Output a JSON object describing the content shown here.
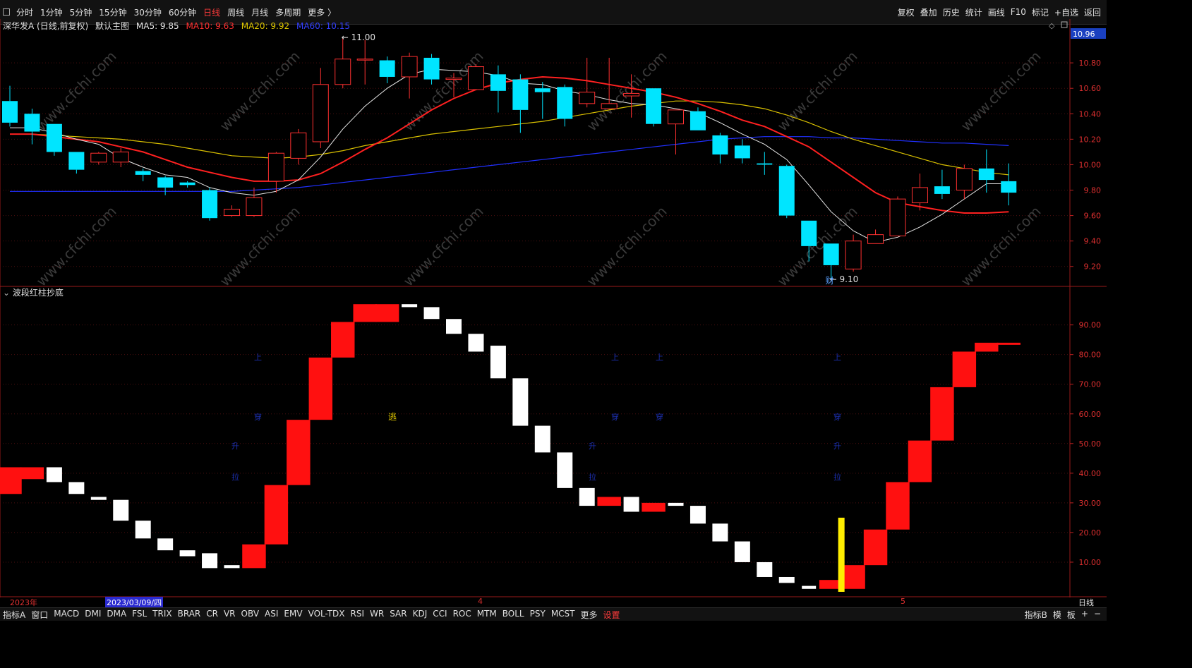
{
  "topbar": {
    "periods": [
      "分时",
      "1分钟",
      "5分钟",
      "15分钟",
      "30分钟",
      "60分钟",
      "日线",
      "周线",
      "月线",
      "多周期",
      "更多 〉"
    ],
    "active_period": "日线",
    "right_buttons": [
      "复权",
      "叠加",
      "历史",
      "统计",
      "画线",
      "F10",
      "标记",
      "+自选",
      "返回"
    ]
  },
  "legend": {
    "title": "深华发A (日线,前复权)",
    "main_chart": "默认主图",
    "ma5": "MA5: 9.85",
    "ma10": "MA10: 9.63",
    "ma20": "MA20: 9.92",
    "ma60": "MA60: 10.15"
  },
  "price_axis": {
    "current_price": "10.96",
    "ticks": [
      "10.80",
      "10.60",
      "10.40",
      "10.20",
      "10.00",
      "9.80",
      "9.60",
      "9.40",
      "9.20"
    ]
  },
  "annotations": {
    "high_label": "11.00",
    "low_label": "9.10",
    "fin_mark": "财"
  },
  "indicator": {
    "title": "波段红柱抄底",
    "ticks": [
      "90.00",
      "80.00",
      "70.00",
      "60.00",
      "50.00",
      "40.00",
      "30.00",
      "20.00",
      "10.00"
    ],
    "signal_escape": "逃",
    "signal_chars": [
      "上",
      "穿",
      "升",
      "拉"
    ]
  },
  "datebar": {
    "year": "2023年",
    "cursor_date": "2023/03/09/四",
    "month4": "4",
    "month5": "5",
    "period": "日线"
  },
  "bottombar": {
    "indicators": [
      "指标A",
      "窗口",
      "MACD",
      "DMI",
      "DMA",
      "FSL",
      "TRIX",
      "BRAR",
      "CR",
      "VR",
      "OBV",
      "ASI",
      "EMV",
      "VOL-TDX",
      "RSI",
      "WR",
      "SAR",
      "KDJ",
      "CCI",
      "ROC",
      "MTM",
      "BOLL",
      "PSY",
      "MCST",
      "更多",
      "设置"
    ],
    "right": [
      "指标B",
      "模",
      "板",
      "+",
      "−"
    ]
  },
  "watermark": "www.cfchi.com",
  "colors": {
    "up": "#ff3030",
    "down": "#00e5ff",
    "ma5": "#e6e6e6",
    "ma10": "#ff2020",
    "ma20": "#d9c000",
    "ma60": "#2030ff"
  },
  "chart_data": [
    {
      "type": "candlestick",
      "ylim": [
        9.06,
        11.1
      ],
      "candles": [
        [
          10.5,
          10.33,
          10.62,
          10.3
        ],
        [
          10.4,
          10.26,
          10.44,
          10.16
        ],
        [
          10.32,
          10.1,
          10.32,
          10.07
        ],
        [
          10.1,
          9.96,
          10.1,
          9.93
        ],
        [
          10.02,
          10.09,
          10.1,
          10.0
        ],
        [
          10.02,
          10.1,
          10.13,
          9.98
        ],
        [
          9.95,
          9.92,
          9.97,
          9.87
        ],
        [
          9.9,
          9.82,
          9.91,
          9.76
        ],
        [
          9.86,
          9.84,
          9.87,
          9.82
        ],
        [
          9.8,
          9.58,
          9.82,
          9.56
        ],
        [
          9.6,
          9.65,
          9.68,
          9.59
        ],
        [
          9.6,
          9.74,
          9.82,
          9.59
        ],
        [
          9.87,
          10.09,
          10.1,
          9.78
        ],
        [
          10.05,
          10.25,
          10.28,
          10.0
        ],
        [
          10.18,
          10.63,
          10.76,
          10.13
        ],
        [
          10.63,
          10.83,
          11.0,
          10.6
        ],
        [
          10.83,
          10.83,
          10.98,
          10.63
        ],
        [
          10.82,
          10.69,
          10.85,
          10.64
        ],
        [
          10.69,
          10.85,
          10.88,
          10.52
        ],
        [
          10.84,
          10.67,
          10.87,
          10.63
        ],
        [
          10.67,
          10.68,
          10.72,
          10.53
        ],
        [
          10.59,
          10.77,
          10.79,
          10.59
        ],
        [
          10.71,
          10.58,
          10.78,
          10.41
        ],
        [
          10.67,
          10.43,
          10.71,
          10.25
        ],
        [
          10.6,
          10.57,
          10.65,
          10.36
        ],
        [
          10.61,
          10.36,
          10.63,
          10.3
        ],
        [
          10.48,
          10.57,
          10.84,
          10.45
        ],
        [
          10.44,
          10.48,
          10.84,
          10.44
        ],
        [
          10.54,
          10.56,
          10.71,
          10.37
        ],
        [
          10.6,
          10.32,
          10.6,
          10.3
        ],
        [
          10.32,
          10.43,
          10.43,
          10.08
        ],
        [
          10.42,
          10.27,
          10.45,
          10.27
        ],
        [
          10.23,
          10.08,
          10.25,
          10.01
        ],
        [
          10.15,
          10.05,
          10.2,
          10.01
        ],
        [
          10.01,
          10.0,
          10.1,
          9.92
        ],
        [
          9.99,
          9.6,
          10.0,
          9.58
        ],
        [
          9.56,
          9.36,
          9.56,
          9.24
        ],
        [
          9.38,
          9.21,
          9.38,
          9.1
        ],
        [
          9.18,
          9.4,
          9.45,
          9.16
        ],
        [
          9.38,
          9.45,
          9.49,
          9.38
        ],
        [
          9.44,
          9.73,
          9.75,
          9.44
        ],
        [
          9.7,
          9.82,
          9.93,
          9.64
        ],
        [
          9.83,
          9.77,
          9.96,
          9.73
        ],
        [
          9.8,
          9.97,
          10.0,
          9.73
        ],
        [
          9.97,
          9.88,
          10.12,
          9.78
        ],
        [
          9.87,
          9.78,
          10.01,
          9.68
        ]
      ],
      "ma5": [
        10.29,
        10.29,
        10.25,
        10.2,
        10.16,
        10.05,
        9.98,
        9.92,
        9.9,
        9.82,
        9.78,
        9.76,
        9.79,
        9.88,
        10.06,
        10.28,
        10.46,
        10.6,
        10.71,
        10.75,
        10.74,
        10.73,
        10.7,
        10.64,
        10.63,
        10.58,
        10.55,
        10.51,
        10.48,
        10.47,
        10.44,
        10.41,
        10.33,
        10.24,
        10.16,
        10.04,
        9.84,
        9.63,
        9.48,
        9.39,
        9.43,
        9.51,
        9.61,
        9.73,
        9.85,
        9.85
      ],
      "ma10": [
        10.24,
        10.24,
        10.22,
        10.2,
        10.18,
        10.14,
        10.1,
        10.04,
        9.98,
        9.94,
        9.9,
        9.87,
        9.87,
        9.88,
        9.93,
        10.02,
        10.12,
        10.21,
        10.32,
        10.43,
        10.52,
        10.59,
        10.64,
        10.67,
        10.69,
        10.68,
        10.66,
        10.63,
        10.6,
        10.57,
        10.53,
        10.48,
        10.42,
        10.35,
        10.3,
        10.22,
        10.14,
        10.02,
        9.9,
        9.78,
        9.7,
        9.67,
        9.64,
        9.62,
        9.62,
        9.63
      ],
      "ma20": [
        10.24,
        10.24,
        10.23,
        10.22,
        10.21,
        10.2,
        10.18,
        10.16,
        10.13,
        10.1,
        10.07,
        10.06,
        10.05,
        10.06,
        10.08,
        10.11,
        10.15,
        10.18,
        10.21,
        10.24,
        10.26,
        10.28,
        10.3,
        10.32,
        10.34,
        10.37,
        10.4,
        10.43,
        10.46,
        10.48,
        10.5,
        10.5,
        10.49,
        10.47,
        10.44,
        10.39,
        10.33,
        10.26,
        10.2,
        10.15,
        10.1,
        10.05,
        10.0,
        9.97,
        9.94,
        9.92
      ],
      "ma60": [
        9.79,
        9.79,
        9.79,
        9.79,
        9.79,
        9.79,
        9.79,
        9.79,
        9.79,
        9.79,
        9.79,
        9.8,
        9.81,
        9.82,
        9.84,
        9.86,
        9.88,
        9.9,
        9.92,
        9.94,
        9.96,
        9.98,
        10.0,
        10.02,
        10.04,
        10.06,
        10.08,
        10.1,
        10.12,
        10.14,
        10.16,
        10.18,
        10.2,
        10.21,
        10.22,
        10.22,
        10.22,
        10.21,
        10.21,
        10.2,
        10.19,
        10.18,
        10.17,
        10.17,
        10.16,
        10.15
      ]
    },
    {
      "type": "bar",
      "ylim": [
        0,
        98
      ],
      "steps": [
        [
          33,
          42,
          "r"
        ],
        [
          38,
          42,
          "r"
        ],
        [
          42,
          37,
          "w"
        ],
        [
          37,
          33,
          "w"
        ],
        [
          32,
          31,
          "w"
        ],
        [
          31,
          24,
          "w"
        ],
        [
          24,
          18,
          "w"
        ],
        [
          18,
          14,
          "w"
        ],
        [
          14,
          12,
          "w"
        ],
        [
          13,
          8,
          "w"
        ],
        [
          9,
          8,
          "w"
        ],
        [
          8,
          16,
          "r"
        ],
        [
          16,
          36,
          "r"
        ],
        [
          36,
          58,
          "r"
        ],
        [
          58,
          79,
          "r"
        ],
        [
          79,
          91,
          "r"
        ],
        [
          91,
          97,
          "r"
        ],
        [
          97,
          91,
          "r"
        ],
        [
          96,
          97,
          "w"
        ],
        [
          96,
          92,
          "w"
        ],
        [
          92,
          87,
          "w"
        ],
        [
          87,
          81,
          "w"
        ],
        [
          83,
          72,
          "w"
        ],
        [
          72,
          56,
          "w"
        ],
        [
          56,
          47,
          "w"
        ],
        [
          47,
          35,
          "w"
        ],
        [
          35,
          29,
          "w"
        ],
        [
          29,
          32,
          "r"
        ],
        [
          32,
          27,
          "w"
        ],
        [
          27,
          30,
          "r"
        ],
        [
          30,
          29,
          "w"
        ],
        [
          29,
          23,
          "w"
        ],
        [
          23,
          17,
          "w"
        ],
        [
          17,
          10,
          "w"
        ],
        [
          10,
          5,
          "w"
        ],
        [
          5,
          3,
          "w"
        ],
        [
          2,
          1,
          "w"
        ],
        [
          1,
          4,
          "r"
        ],
        [
          1,
          9,
          "r"
        ],
        [
          9,
          21,
          "r"
        ],
        [
          21,
          37,
          "r"
        ],
        [
          37,
          51,
          "r"
        ],
        [
          51,
          69,
          "r"
        ],
        [
          69,
          81,
          "r"
        ],
        [
          81,
          84,
          "r"
        ],
        [
          84,
          84,
          "r"
        ]
      ],
      "yellow_index": 37,
      "yellow_value": 25
    }
  ]
}
